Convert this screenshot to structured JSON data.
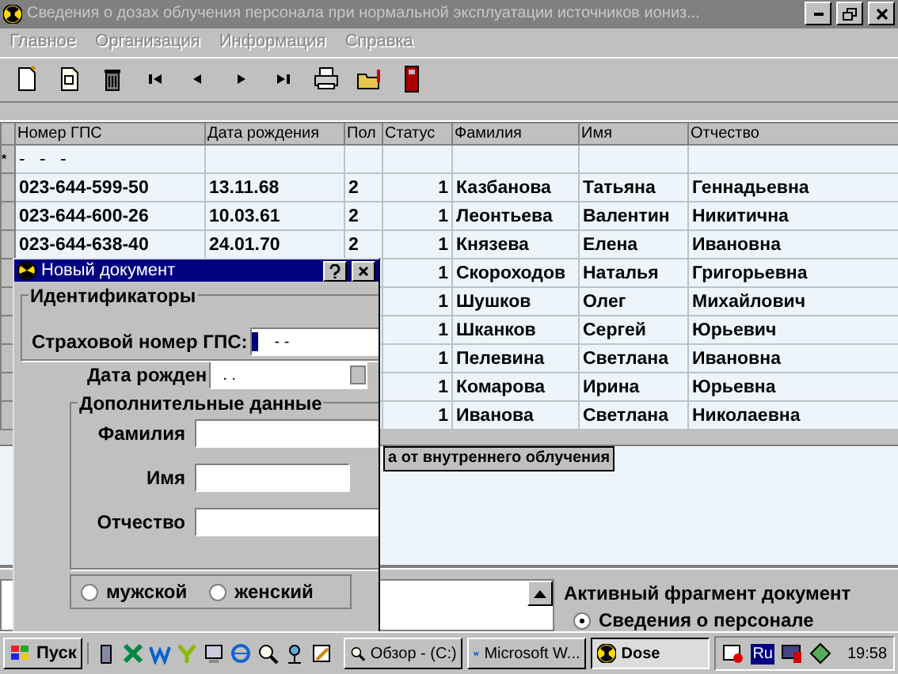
{
  "window": {
    "title": "Сведения о дозах облучения персонала при нормальной эксплуатации источников иониз..."
  },
  "menu": [
    {
      "label": "Главное",
      "disabled": true
    },
    {
      "label": "Организация",
      "disabled": true
    },
    {
      "label": "Информация",
      "disabled": true
    },
    {
      "label": "Справка",
      "disabled": true
    }
  ],
  "table": {
    "columns": [
      "Номер ГПС",
      "Дата рождения",
      "Пол",
      "Статус",
      "Фамилия",
      "Имя",
      "Отчество"
    ],
    "rows": [
      {
        "marker": "*",
        "gps": "- - -"
      },
      {
        "gps": "023-644-599-50",
        "birth_date": "13.11.68",
        "sex": "2",
        "status": "1",
        "surname": "Казбанова",
        "name": "Татьяна",
        "patronymic": "Геннадьевна"
      },
      {
        "gps": "023-644-600-26",
        "birth_date": "10.03.61",
        "sex": "2",
        "status": "1",
        "surname": "Леонтьева",
        "name": "Валентин",
        "patronymic": "Никитична"
      },
      {
        "gps": "023-644-638-40",
        "birth_date": "24.01.70",
        "sex": "2",
        "status": "1",
        "surname": "Князева",
        "name": "Елена",
        "patronymic": "Ивановна"
      },
      {
        "status": "1",
        "surname": "Скороходов",
        "name": "Наталья",
        "patronymic": "Григорьевна"
      },
      {
        "status": "1",
        "surname": "Шушков",
        "name": "Олег",
        "patronymic": "Михайлович"
      },
      {
        "status": "1",
        "surname": "Шканков",
        "name": "Сергей",
        "patronymic": "Юрьевич"
      },
      {
        "status": "1",
        "surname": "Пелевина",
        "name": "Светлана",
        "patronymic": "Ивановна"
      },
      {
        "status": "1",
        "surname": "Комарова",
        "name": "Ирина",
        "patronymic": "Юрьевна"
      },
      {
        "status": "1",
        "surname": "Иванова",
        "name": "Светлана",
        "patronymic": "Николаевна"
      }
    ]
  },
  "lower_tab": {
    "label": "а от внутреннего облучения"
  },
  "active_fragment": {
    "title": "Активный фрагмент документ",
    "options": [
      {
        "label": "Сведения о персонале",
        "selected": true
      }
    ]
  },
  "dialog": {
    "title": "Новый документ",
    "identifiers": {
      "title": "Идентификаторы",
      "gps_label": "Страховой номер ГПС:",
      "gps_value": "- -",
      "date_label": "Дата рожден",
      "date_value": ". ."
    },
    "extra": {
      "title": "Дополнительные данные",
      "fields": [
        {
          "label": "Фамилия"
        },
        {
          "label": "Имя"
        },
        {
          "label": "Отчество"
        }
      ]
    },
    "sex_options": [
      {
        "label": "мужской",
        "selected": false
      },
      {
        "label": "женский",
        "selected": false
      }
    ]
  },
  "taskbar": {
    "start": "Пуск",
    "tasks": [
      {
        "label": "Обзор - (C:)",
        "selected": false
      },
      {
        "label": "Microsoft W...",
        "selected": false
      },
      {
        "label": "Dose",
        "selected": true
      }
    ],
    "language": "Ru",
    "clock": "19:58"
  }
}
